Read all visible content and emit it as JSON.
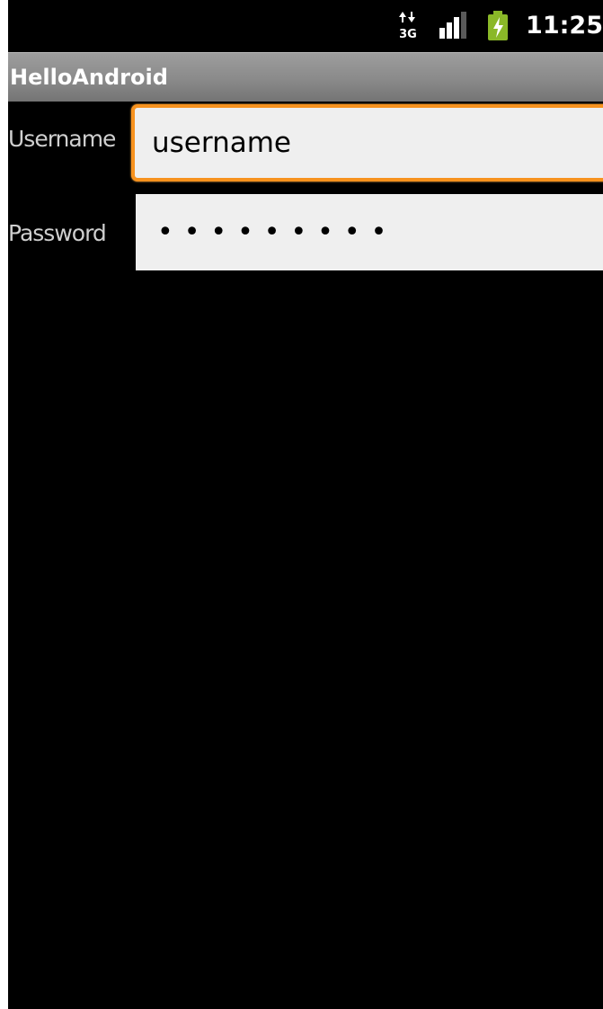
{
  "status_bar": {
    "network_icon": "3g-data-arrows-icon",
    "network_type": "3G",
    "signal_icon": "signal-strength-icon",
    "battery_icon": "battery-charging-icon",
    "time": "11:25"
  },
  "title_bar": {
    "title": "HelloAndroid"
  },
  "form": {
    "username": {
      "label": "Username",
      "value": "username"
    },
    "password": {
      "label": "Password",
      "masked_value": "•••••••••"
    }
  },
  "colors": {
    "background": "#000000",
    "title_bar": "#8a8a8a",
    "field_background": "#efefef",
    "focus_border": "#f7921e",
    "label_text": "#cfcfcf"
  }
}
